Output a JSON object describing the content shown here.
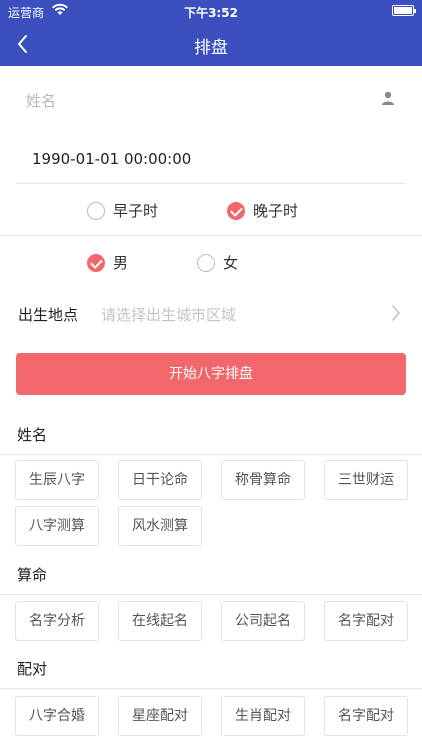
{
  "status_bar": {
    "carrier": "运营商",
    "time": "下午3:52"
  },
  "nav": {
    "title": "排盘"
  },
  "form": {
    "name_placeholder": "姓名",
    "datetime": "1990-01-01 00:00:00",
    "zishi_options": [
      {
        "label": "早子时",
        "checked": false
      },
      {
        "label": "晚子时",
        "checked": true
      }
    ],
    "gender_options": [
      {
        "label": "男",
        "checked": true
      },
      {
        "label": "女",
        "checked": false
      }
    ],
    "birthplace_label": "出生地点",
    "birthplace_placeholder": "请选择出生城市区域",
    "submit_label": "开始八字排盘"
  },
  "sections": [
    {
      "title": "姓名",
      "items": [
        "生辰八字",
        "日干论命",
        "称骨算命",
        "三世财运",
        "八字测算",
        "风水测算"
      ]
    },
    {
      "title": "算命",
      "items": [
        "名字分析",
        "在线起名",
        "公司起名",
        "名字配对"
      ]
    },
    {
      "title": "配对",
      "items": [
        "八字合婚",
        "星座配对",
        "生肖配对",
        "名字配对"
      ]
    }
  ],
  "colors": {
    "primary": "#3b4fbf",
    "accent": "#f2676b"
  }
}
